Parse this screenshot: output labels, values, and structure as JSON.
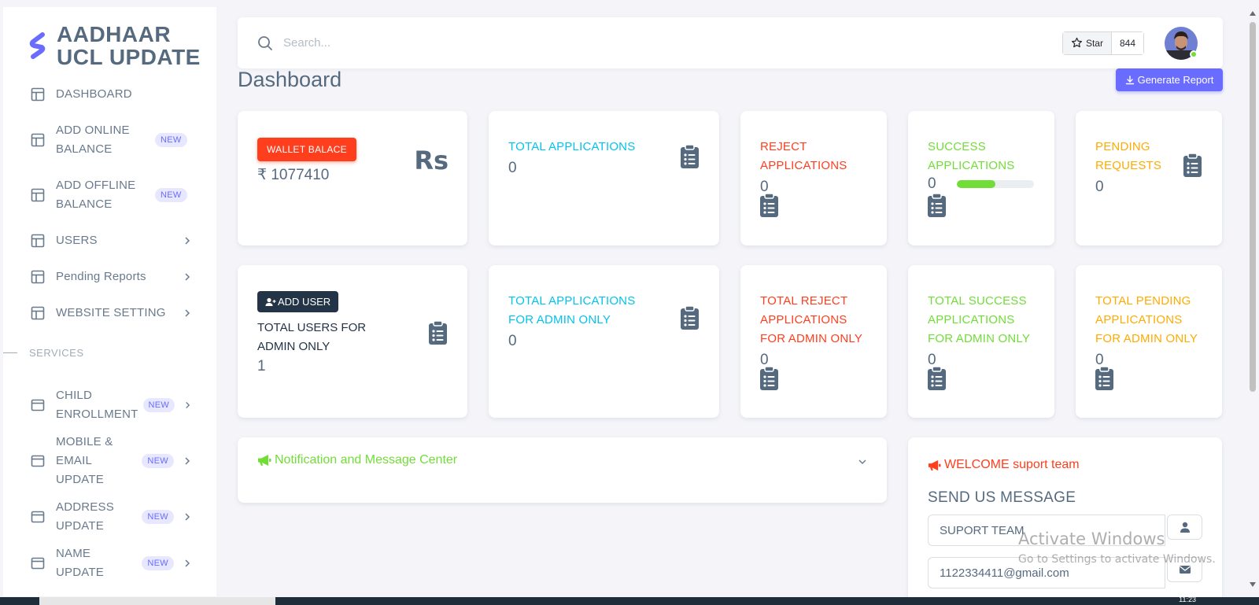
{
  "brand": {
    "line1": "AADHAAR",
    "line2": "UCL UPDATE"
  },
  "sidebar": {
    "items": [
      {
        "label": "DASHBOARD"
      },
      {
        "label": "ADD ONLINE BALANCE",
        "badge": "NEW"
      },
      {
        "label": "ADD OFFLINE BALANCE",
        "badge": "NEW"
      },
      {
        "label": "USERS"
      },
      {
        "label": "Pending Reports"
      },
      {
        "label": "WEBSITE SETTING"
      }
    ],
    "section_header": "SERVICES",
    "services": [
      {
        "label": "CHILD ENROLLMENT",
        "badge": "NEW"
      },
      {
        "label": "MOBILE & EMAIL UPDATE",
        "badge": "NEW"
      },
      {
        "label": "ADDRESS UPDATE",
        "badge": "NEW"
      },
      {
        "label": "NAME UPDATE",
        "badge": "NEW"
      }
    ]
  },
  "search": {
    "placeholder": "Search..."
  },
  "github": {
    "star_label": "Star",
    "count": "844"
  },
  "page": {
    "title": "Dashboard",
    "generate_report": "Generate Report"
  },
  "cards_row1": {
    "wallet": {
      "badge": "WALLET BALACE",
      "value": "₹ 1077410",
      "currency_mark": "Rs"
    },
    "total_applications": {
      "title": "TOTAL APPLICATIONS",
      "value": "0"
    },
    "reject": {
      "title": "REJECT APPLICATIONS",
      "value": "0"
    },
    "success": {
      "title": "SUCCESS APPLICATIONS",
      "value": "0",
      "progress": 0.5
    },
    "pending": {
      "title": "PENDING REQUESTS",
      "value": "0"
    }
  },
  "cards_row2": {
    "users": {
      "button": "ADD USER",
      "title": "TOTAL USERS FOR ADMIN ONLY",
      "value": "1"
    },
    "total_applications_admin": {
      "title": "TOTAL APPLICATIONS FOR ADMIN ONLY",
      "value": "0"
    },
    "reject_admin": {
      "title": "TOTAL REJECT APPLICATIONS FOR ADMIN ONLY",
      "value": "0"
    },
    "success_admin": {
      "title": "TOTAL SUCCESS APPLICATIONS FOR ADMIN ONLY",
      "value": "0"
    },
    "pending_admin": {
      "title": "TOTAL PENDING APPLICATIONS FOR ADMIN ONLY",
      "value": "0"
    }
  },
  "notification": {
    "title": "Notification and Message Center"
  },
  "contact": {
    "welcome": "WELCOME suport team",
    "heading": "SEND US MESSAGE",
    "name_value": "SUPORT TEAM",
    "email_value": "1122334411@gmail.com"
  },
  "watermark": {
    "line1": "Activate Windows",
    "line2": "Go to Settings to activate Windows."
  },
  "taskbar": {
    "time": "11:23"
  },
  "colors": {
    "primary": "#696cff",
    "info": "#03c3ec",
    "danger": "#ff3e1d",
    "success": "#71dd37",
    "warning": "#ffab00",
    "dark": "#233446"
  }
}
